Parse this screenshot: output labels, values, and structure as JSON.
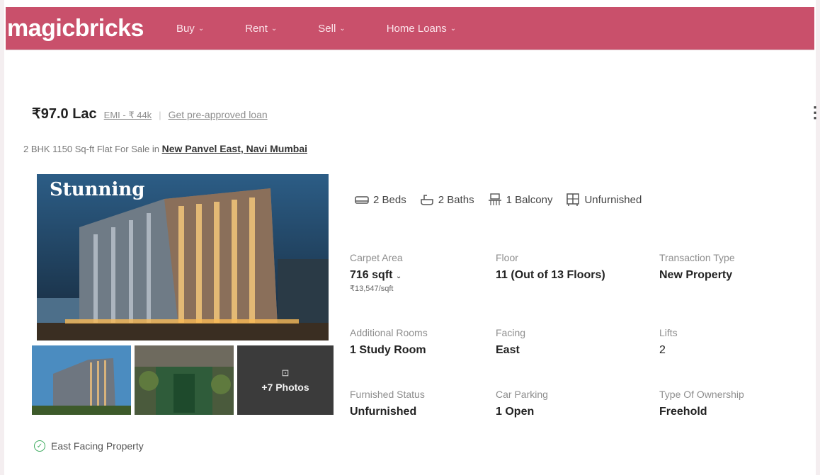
{
  "header": {
    "logo": "magicbricks",
    "nav": [
      {
        "label": "Buy"
      },
      {
        "label": "Rent"
      },
      {
        "label": "Sell"
      },
      {
        "label": "Home Loans"
      }
    ]
  },
  "listing": {
    "price": "₹97.0 Lac",
    "emi": "EMI - ₹ 44k",
    "separator": "|",
    "loan_link": "Get pre-approved loan",
    "subtitle_prefix": "2 BHK 1150 Sq-ft Flat For Sale in",
    "locality": "New Panvel East, Navi Mumbai",
    "photo_caption": "Stunning",
    "more_photos": "+7 Photos",
    "amenities": [
      {
        "label": "2 Beds",
        "icon": "bed-icon"
      },
      {
        "label": "2 Baths",
        "icon": "bath-icon"
      },
      {
        "label": "1 Balcony",
        "icon": "balcony-icon"
      },
      {
        "label": "Unfurnished",
        "icon": "furniture-icon"
      }
    ],
    "details": {
      "carpet_area": {
        "label": "Carpet Area",
        "value": "716 sqft",
        "note": "₹13,547/sqft"
      },
      "floor": {
        "label": "Floor",
        "value": "11 (Out of 13 Floors)"
      },
      "transaction": {
        "label": "Transaction Type",
        "value": "New Property"
      },
      "additional_rooms": {
        "label": "Additional Rooms",
        "value": "1 Study Room"
      },
      "facing": {
        "label": "Facing",
        "value": "East"
      },
      "lifts": {
        "label": "Lifts",
        "value": "2"
      },
      "furnished": {
        "label": "Furnished Status",
        "value": "Unfurnished"
      },
      "parking": {
        "label": "Car Parking",
        "value": "1 Open"
      },
      "ownership": {
        "label": "Type Of Ownership",
        "value": "Freehold"
      }
    },
    "highlight": "East Facing Property"
  },
  "colors": {
    "brand": "#c9506b",
    "check": "#3aaa5c"
  }
}
